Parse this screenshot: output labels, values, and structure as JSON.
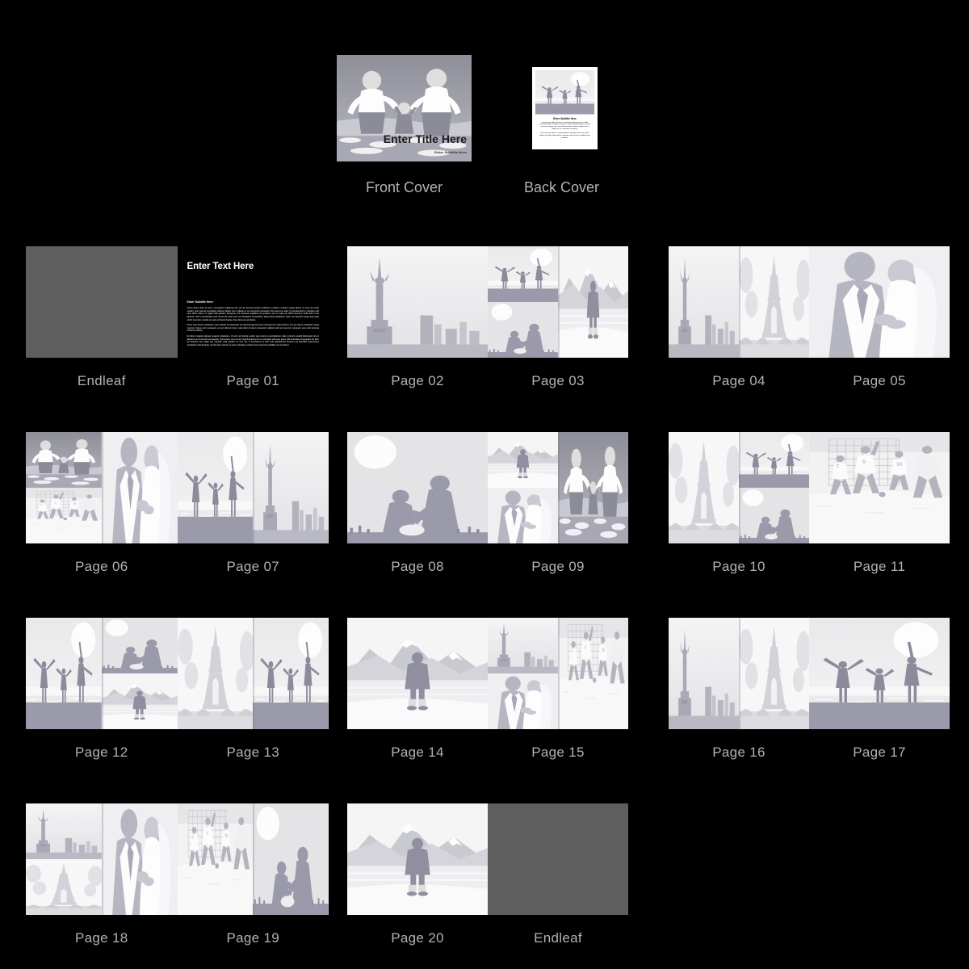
{
  "app": {
    "title": "Album Page Overview",
    "background_color": "#000000",
    "label_color": "#b2b2b2",
    "endleaf_color": "#5e5e5e",
    "page_color": "#ececed"
  },
  "covers": [
    {
      "label": "Front Cover",
      "kind": "front-cover",
      "title": "Enter Title Here",
      "subtitle": "Enter Subtitle Here",
      "art": "family-beach-holding-hands"
    },
    {
      "label": "Back Cover",
      "kind": "back-cover",
      "subtitle": "Enter Subtitle Here",
      "art": "kids-beach-sunset",
      "body": [
        "Lorem ipsum dolor sit amet, consectetur adipiscing elit, sed do eiusmod tempor incididunt ut labore et dolore magna aliqua. Ut enim ad minim veniam, quis nostrud exercitation ullamco laboris nisi ut aliquip ex ea commodo consequat.",
        "Duis aute irure dolor in reprehenderit in voluptate velit esse cillum dolore eu fugiat nulla pariatur excepteur sint occaecat cupidatat non proident."
      ]
    }
  ],
  "spreads": [
    {
      "row": 1,
      "pages": [
        {
          "label": "Endleaf",
          "kind": "endleaf"
        },
        {
          "label": "Page 01",
          "kind": "text",
          "title": "Enter Text Here",
          "subtitle": "Enter Subtitle Here",
          "body": [
            "Lorem ipsum dolor sit amet, consectetur adipiscing elit, sed do eiusmod tempor incididunt ut labore et dolore magna aliqua. Ut enim ad minim veniam, quis nostrud exercitation ullamco laboris nisi ut aliquip ex ea commodo consequat. Duis aute irure dolor in reprehenderit in voluptate velit esse cillum dolore eu fugiat nulla pariatur. Excepteur sint occaecat cupidatat non proident, sunt in culpa qui officia deserunt mollit anim id est laborum. Sed ut perspiciatis unde omnis iste natus error sit voluptatem accusantium doloremque laudantium totam rem aperiam eaque ipsa quae ab illo inventore veritatis et quasi architecto beatae vitae dicta sunt explicabo.",
            "Nemo enim ipsam voluptatem quia voluptas sit aspernatur aut odit aut fugit sed quia consequuntur magni dolores eos qui ratione voluptatem sequi nesciunt. Neque porro quisquam est qui dolorem ipsum quia dolor sit amet consectetur adipisci velit sed quia non numquam eius modi tempora incidunt ut labore.",
            "Et dolore magnam aliquam quaerat voluptatem. Ut enim ad minima veniam quis nostrum exercitationem ullam corporis suscipit laboriosam nisi ut aliquid ex ea commodi consequatur. Quis autem vel eum iure reprehenderit qui in ea voluptate velit esse quam nihil molestiae consequatur vel illum qui dolorem eum fugiat quo voluptas nulla pariatur. At vero eos et accusamus et iusto odio dignissimos ducimus qui blanditiis praesentium voluptatum deleniti atque corrupti quos dolores et quas molestias excepturi sint occaecati cupiditate non provident."
          ]
        }
      ]
    },
    {
      "row": 1,
      "pages": [
        {
          "label": "Page 02",
          "kind": "photo",
          "layout": "full",
          "art": [
            "liberty-skyline"
          ]
        },
        {
          "label": "Page 03",
          "kind": "photo",
          "layout": "stack-plus-one",
          "art": [
            "kids-beach-sunset",
            "couple-proposal",
            "lake-mountains-person"
          ]
        }
      ]
    },
    {
      "row": 1,
      "pages": [
        {
          "label": "Page 04",
          "kind": "photo",
          "layout": "two-up",
          "art": [
            "liberty-skyline",
            "eiffel-tower"
          ]
        },
        {
          "label": "Page 05",
          "kind": "photo",
          "layout": "full",
          "art": [
            "wedding-couple"
          ]
        }
      ]
    },
    {
      "row": 2,
      "pages": [
        {
          "label": "Page 06",
          "kind": "photo",
          "layout": "stack-plus-one",
          "art": [
            "family-beach-holding-hands",
            "soccer-match",
            "wedding-couple"
          ]
        },
        {
          "label": "Page 07",
          "kind": "photo",
          "layout": "two-up",
          "art": [
            "kids-beach-sunset",
            "liberty-skyline"
          ]
        }
      ]
    },
    {
      "row": 2,
      "pages": [
        {
          "label": "Page 08",
          "kind": "photo",
          "layout": "full",
          "art": [
            "couple-proposal"
          ]
        },
        {
          "label": "Page 09",
          "kind": "photo",
          "layout": "stack-plus-one",
          "art": [
            "lake-mountains-person",
            "wedding-couple",
            "family-beach-holding-hands"
          ]
        }
      ]
    },
    {
      "row": 2,
      "pages": [
        {
          "label": "Page 10",
          "kind": "photo",
          "layout": "stack-plus-one-left",
          "art": [
            "eiffel-tower",
            "kids-beach-sunset",
            "couple-proposal"
          ]
        },
        {
          "label": "Page 11",
          "kind": "photo",
          "layout": "full",
          "art": [
            "soccer-match"
          ]
        }
      ]
    },
    {
      "row": 3,
      "pages": [
        {
          "label": "Page 12",
          "kind": "photo",
          "layout": "stack-plus-one-left",
          "art": [
            "kids-beach-sunset",
            "couple-proposal",
            "lake-mountains-person"
          ]
        },
        {
          "label": "Page 13",
          "kind": "photo",
          "layout": "two-up",
          "art": [
            "eiffel-tower",
            "kids-beach-sunset"
          ]
        }
      ]
    },
    {
      "row": 3,
      "pages": [
        {
          "label": "Page 14",
          "kind": "photo",
          "layout": "full",
          "art": [
            "lake-mountains-person"
          ]
        },
        {
          "label": "Page 15",
          "kind": "photo",
          "layout": "stack-plus-one",
          "art": [
            "liberty-skyline",
            "wedding-couple",
            "soccer-match"
          ]
        }
      ]
    },
    {
      "row": 3,
      "pages": [
        {
          "label": "Page 16",
          "kind": "photo",
          "layout": "two-up",
          "art": [
            "liberty-skyline",
            "eiffel-tower"
          ]
        },
        {
          "label": "Page 17",
          "kind": "photo",
          "layout": "full",
          "art": [
            "kids-beach-sunset"
          ]
        }
      ]
    },
    {
      "row": 4,
      "pages": [
        {
          "label": "Page 18",
          "kind": "photo",
          "layout": "stack-plus-one",
          "art": [
            "liberty-skyline",
            "eiffel-tower",
            "wedding-couple"
          ]
        },
        {
          "label": "Page 19",
          "kind": "photo",
          "layout": "two-up",
          "art": [
            "soccer-match",
            "couple-proposal"
          ]
        }
      ]
    },
    {
      "row": 4,
      "pages": [
        {
          "label": "Page 20",
          "kind": "photo",
          "layout": "full",
          "art": [
            "lake-mountains-person"
          ]
        },
        {
          "label": "Endleaf",
          "kind": "endleaf"
        }
      ]
    }
  ]
}
